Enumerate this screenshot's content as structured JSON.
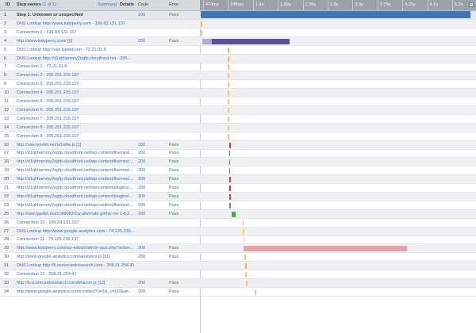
{
  "header": {
    "id_label": "ID",
    "step_names_label": "Step names",
    "step_count": "(1 of 1)",
    "summary_link": "Summary",
    "separator": "|",
    "details_label": "Details",
    "code_label": "Code",
    "error_label": "Error",
    "corner_button": "+"
  },
  "timeline_ticks": [
    "474ms",
    "948ms",
    "1.4s",
    "1.89s",
    "2.36s",
    "2.8s",
    "3.3s",
    "3.79s",
    "4.25s",
    "4.7s",
    "5.2s"
  ],
  "colors": {
    "step_bar": "#3f74b8",
    "dns": "#f0b955",
    "connect": "#f5c58f",
    "html": "#5a4ea0",
    "html_light": "#b1a9d3",
    "css": "#4f9f55",
    "js": "#b7424a",
    "wait": "#e9a0aa",
    "grey": "#cfcfd8"
  },
  "rows": [
    {
      "id": "1",
      "name": "Step 1: Unknown or unspecified",
      "code": "200",
      "error": "Pass",
      "bar": {
        "start": 0.0,
        "end": 1.0,
        "color": "step_bar"
      }
    },
    {
      "id": "2",
      "name": "DNS Lookup http://www.katyperry.com - 199.83.131.107",
      "code": "",
      "error": "",
      "bar": {
        "start": 0.0,
        "end": 0.005,
        "color": "dns"
      }
    },
    {
      "id": "3",
      "name": "Connection 0 - 199.83.131.107",
      "code": "",
      "error": "",
      "bar": {
        "start": 0.0,
        "end": 0.004,
        "color": "connect"
      }
    },
    {
      "id": "4",
      "name": "http://www.katyperry.com/ [0]",
      "code": "200",
      "error": "Pass",
      "bar": {
        "start": 0.005,
        "end": 0.33,
        "color": "html"
      }
    },
    {
      "id": "5",
      "name": "DNS Lookup http://use.typekit.net - 72.21.91.8",
      "code": "",
      "error": "",
      "bar": {
        "start": 0.1,
        "end": 0.103,
        "color": "dns"
      }
    },
    {
      "id": "6",
      "name": "DNS Lookup http://d1qhhammy2egfp.cloudfront.net - 205...",
      "code": "",
      "error": "",
      "bar": {
        "start": 0.1,
        "end": 0.103,
        "color": "dns"
      }
    },
    {
      "id": "7",
      "name": "Connection 1 - 72.21.91.8",
      "code": "",
      "error": "",
      "bar": {
        "start": 0.1,
        "end": 0.103,
        "color": "connect"
      }
    },
    {
      "id": "8",
      "name": "Connection 2 - 205.251.215.107",
      "code": "",
      "error": "",
      "bar": {
        "start": 0.1,
        "end": 0.103,
        "color": "connect"
      }
    },
    {
      "id": "9",
      "name": "Connection 3 - 205.251.215.107",
      "code": "",
      "error": "",
      "bar": {
        "start": 0.1,
        "end": 0.103,
        "color": "connect"
      }
    },
    {
      "id": "10",
      "name": "Connection 4 - 205.251.215.107",
      "code": "",
      "error": "",
      "bar": {
        "start": 0.1,
        "end": 0.103,
        "color": "connect"
      }
    },
    {
      "id": "11",
      "name": "Connection 5 - 205.251.215.107",
      "code": "",
      "error": "",
      "bar": {
        "start": 0.1,
        "end": 0.103,
        "color": "connect"
      }
    },
    {
      "id": "12",
      "name": "Connection 6 - 205.251.215.107",
      "code": "",
      "error": "",
      "bar": {
        "start": 0.1,
        "end": 0.103,
        "color": "connect"
      }
    },
    {
      "id": "13",
      "name": "Connection 7 - 205.251.215.107",
      "code": "",
      "error": "",
      "bar": {
        "start": 0.1,
        "end": 0.103,
        "color": "connect"
      }
    },
    {
      "id": "14",
      "name": "Connection 8 - 205.251.215.107",
      "code": "",
      "error": "",
      "bar": {
        "start": 0.1,
        "end": 0.103,
        "color": "connect"
      }
    },
    {
      "id": "15",
      "name": "Connection 9 - 205.251.215.107",
      "code": "",
      "error": "",
      "bar": {
        "start": 0.1,
        "end": 0.103,
        "color": "connect"
      }
    },
    {
      "id": "16",
      "name": "http://use.typekit.net/ol1whe.js [1]",
      "code": "200",
      "error": "Pass",
      "bar": {
        "start": 0.105,
        "end": 0.113,
        "color": "js"
      }
    },
    {
      "id": "17",
      "name": "http://d1qhhammy2egfp.cloudfront.net/wp-content/themes/...",
      "code": "200",
      "error": "Pass",
      "bar": {
        "start": 0.105,
        "end": 0.11,
        "color": "css"
      }
    },
    {
      "id": "18",
      "name": "http://d1qhhammy2egfp.cloudfront.net/wp-content/themes/...",
      "code": "200",
      "error": "Pass",
      "bar": {
        "start": 0.105,
        "end": 0.109,
        "color": "css"
      }
    },
    {
      "id": "19",
      "name": "http://d1qhhammy2egfp.cloudfront.net/wp-content/themes/...",
      "code": "200",
      "error": "Pass",
      "bar": {
        "start": 0.105,
        "end": 0.109,
        "color": "css"
      }
    },
    {
      "id": "20",
      "name": "http://d1qhhammy2egfp.cloudfront.net/wp-content/themes/...",
      "code": "200",
      "error": "Pass",
      "bar": {
        "start": 0.106,
        "end": 0.109,
        "color": "js"
      }
    },
    {
      "id": "21",
      "name": "http://d1qhhammy2egfp.cloudfront.net/wp-content/plugins/...",
      "code": "200",
      "error": "Pass",
      "bar": {
        "start": 0.106,
        "end": 0.109,
        "color": "js"
      }
    },
    {
      "id": "22",
      "name": "http://d1qhhammy2egfp.cloudfront.net/wp-content/plugins/...",
      "code": "200",
      "error": "Pass",
      "bar": {
        "start": 0.106,
        "end": 0.109,
        "color": "js"
      }
    },
    {
      "id": "23",
      "name": "http://d1qhhammy2egfp.cloudfront.net/wp-content/themes/...",
      "code": "200",
      "error": "Pass",
      "bar": {
        "start": 0.106,
        "end": 0.11,
        "color": "css"
      }
    },
    {
      "id": "25",
      "name": "http://use.typekit.net/c/3f9083/1w;alternate-gothic-no-1-d,2...",
      "code": "200",
      "error": "Pass",
      "bar": {
        "start": 0.115,
        "end": 0.13,
        "color": "css"
      }
    },
    {
      "id": "26",
      "name": "Connection 10 - 199.83.131.107",
      "code": "",
      "error": "",
      "bar": {
        "start": 0.155,
        "end": 0.158,
        "color": "connect"
      }
    },
    {
      "id": "27",
      "name": "DNS Lookup http://www.google-analytics.com - 74.125.239...",
      "code": "",
      "error": "",
      "bar": {
        "start": 0.155,
        "end": 0.158,
        "color": "dns"
      }
    },
    {
      "id": "28",
      "name": "Connection 11 - 74.125.239.137",
      "code": "",
      "error": "",
      "bar": {
        "start": 0.158,
        "end": 0.161,
        "color": "connect"
      }
    },
    {
      "id": "29",
      "name": "http://www.katyperry.com/wp-admin/admin-ajax.php?action...",
      "code": "200",
      "error": "Pass",
      "bar": {
        "start": 0.16,
        "end": 0.765,
        "color": "wait"
      }
    },
    {
      "id": "30",
      "name": "http://www.google-analytics.com/analytics.js [11]",
      "code": "200",
      "error": "Pass",
      "bar": {
        "start": 0.162,
        "end": 0.166,
        "color": "connect"
      }
    },
    {
      "id": "31",
      "name": "DNS Lookup http://b.scorecardresearch.com - 208.31.254.41",
      "code": "",
      "error": "",
      "bar": {
        "start": 0.165,
        "end": 0.168,
        "color": "dns"
      }
    },
    {
      "id": "32",
      "name": "Connection 12 - 208.31.254.41",
      "code": "",
      "error": "",
      "bar": {
        "start": 0.166,
        "end": 0.169,
        "color": "connect"
      }
    },
    {
      "id": "33",
      "name": "http://b.scorecardresearch.com/beacon.js [12]",
      "code": "200",
      "error": "Pass",
      "bar": {
        "start": 0.168,
        "end": 0.173,
        "color": "connect"
      }
    },
    {
      "id": "34",
      "name": "http://www.google-analytics.com/r/collect?v=1&_v=j32&a=...",
      "code": "200",
      "error": "Pass",
      "bar": {
        "start": 0.2,
        "end": 0.204,
        "color": "grey"
      }
    }
  ]
}
